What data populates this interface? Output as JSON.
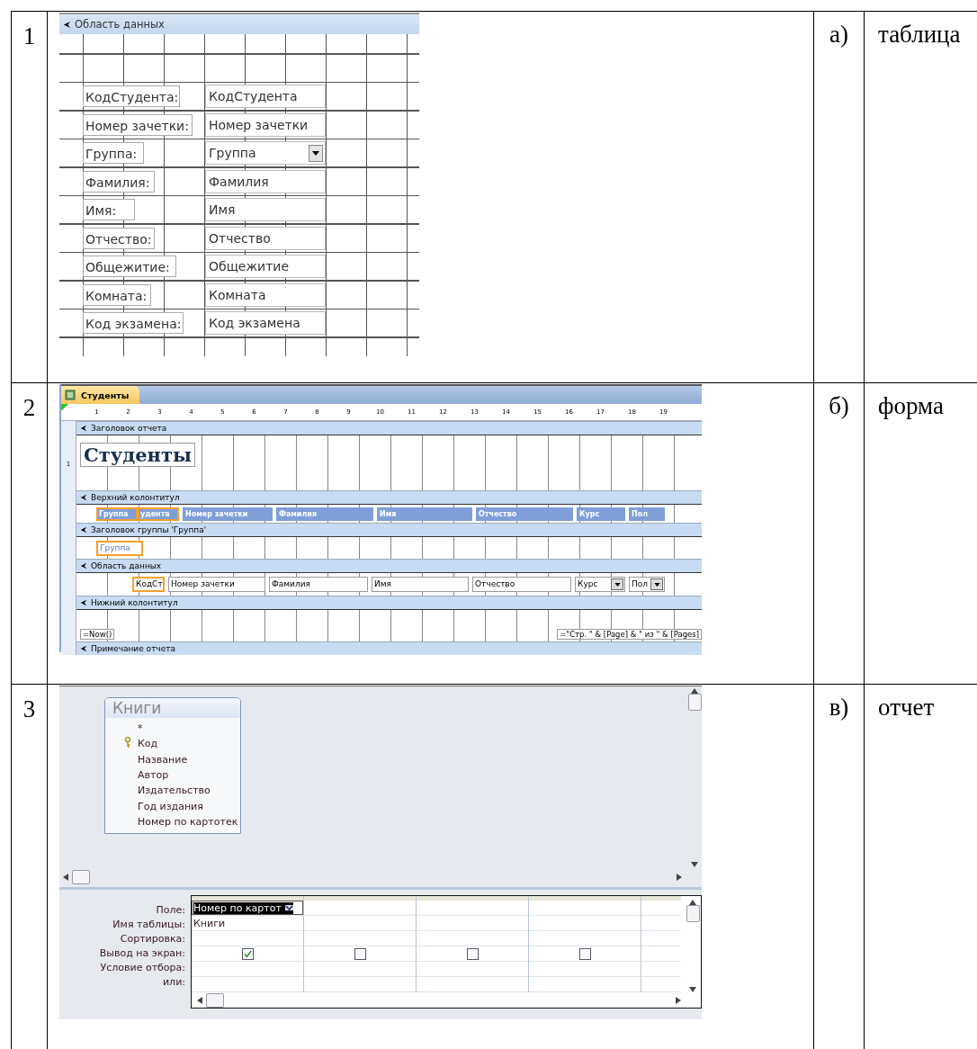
{
  "rows": [
    {
      "number": "1",
      "letter": "а)",
      "word": "таблица",
      "panel": {
        "kind": "form_design",
        "section": "Область данных",
        "controls": [
          {
            "label": "КодСтудента:",
            "field": "КодСтудента",
            "combo": false
          },
          {
            "label": "Номер зачетки:",
            "field": "Номер зачетки",
            "combo": false
          },
          {
            "label": "Группа:",
            "field": "Группа",
            "combo": true
          },
          {
            "label": "Фамилия:",
            "field": "Фамилия",
            "combo": false
          },
          {
            "label": "Имя:",
            "field": "Имя",
            "combo": false
          },
          {
            "label": "Отчество:",
            "field": "Отчество",
            "combo": false
          },
          {
            "label": "Общежитие:",
            "field": "Общежитие",
            "combo": false
          },
          {
            "label": "Комната:",
            "field": "Комната",
            "combo": false
          },
          {
            "label": "Код экзамена:",
            "field": "Код экзамена",
            "combo": false
          }
        ]
      }
    },
    {
      "number": "2",
      "letter": "б)",
      "word": "форма",
      "panel": {
        "kind": "report_design",
        "tab": "Студенты",
        "ruler": [
          "1",
          "2",
          "3",
          "4",
          "5",
          "6",
          "7",
          "8",
          "9",
          "10",
          "11",
          "12",
          "13",
          "14",
          "15",
          "16",
          "17",
          "18",
          "19"
        ],
        "vertical_ruler": "1",
        "sections": [
          {
            "kind": "title",
            "band": "Заголовок отчета",
            "title": "Студенты"
          },
          {
            "kind": "headers",
            "band": "Верхний колонтитул",
            "items": [
              {
                "text": "Группа",
                "selected": true
              },
              {
                "text": "удента",
                "selected": true
              },
              {
                "text": "Номер зачетки",
                "selected": false
              },
              {
                "text": "Фамилия",
                "selected": false
              },
              {
                "text": "Имя",
                "selected": false
              },
              {
                "text": "Отчество",
                "selected": false
              },
              {
                "text": "Курс",
                "selected": false
              },
              {
                "text": "Пол",
                "selected": false
              }
            ]
          },
          {
            "kind": "group",
            "band": "Заголовок группы 'Группа'",
            "items": [
              {
                "text": "Группа",
                "selected": true
              }
            ]
          },
          {
            "kind": "detail",
            "band": "Область данных",
            "items": [
              {
                "text": "КодСт",
                "selected": true,
                "combo": false
              },
              {
                "text": "Номер зачетки",
                "selected": false,
                "combo": false
              },
              {
                "text": "Фамилия",
                "selected": false,
                "combo": false
              },
              {
                "text": "Имя",
                "selected": false,
                "combo": false
              },
              {
                "text": "Отчество",
                "selected": false,
                "combo": false
              },
              {
                "text": "Курс",
                "selected": false,
                "combo": true
              },
              {
                "text": "Пол",
                "selected": false,
                "combo": true
              }
            ]
          },
          {
            "kind": "footer",
            "band": "Нижний колонтитул",
            "left": "=Now()",
            "right": "=\"Стр. \" & [Page] & \" из \" & [Pages]"
          },
          {
            "kind": "empty",
            "band": "Примечание отчета"
          }
        ]
      }
    },
    {
      "number": "3",
      "letter": "в)",
      "word": "отчет",
      "panel": {
        "kind": "query_design",
        "table": {
          "name": "Книги",
          "fields": [
            {
              "name": "*",
              "key": false
            },
            {
              "name": "Код",
              "key": true
            },
            {
              "name": "Название",
              "key": false
            },
            {
              "name": "Автор",
              "key": false
            },
            {
              "name": "Издательство",
              "key": false
            },
            {
              "name": "Год издания",
              "key": false
            },
            {
              "name": "Номер по картотек",
              "key": false
            }
          ]
        },
        "grid": {
          "labels": [
            "Поле:",
            "Имя таблицы:",
            "Сортировка:",
            "Вывод на экран:",
            "Условие отбора:",
            "или:"
          ],
          "columns": [
            {
              "field": "Номер по картот",
              "table": "Книги",
              "selected": true,
              "show": true
            },
            {
              "selected": false,
              "show": false
            },
            {
              "selected": false,
              "show": false
            },
            {
              "selected": false,
              "show": false
            }
          ]
        }
      }
    }
  ]
}
